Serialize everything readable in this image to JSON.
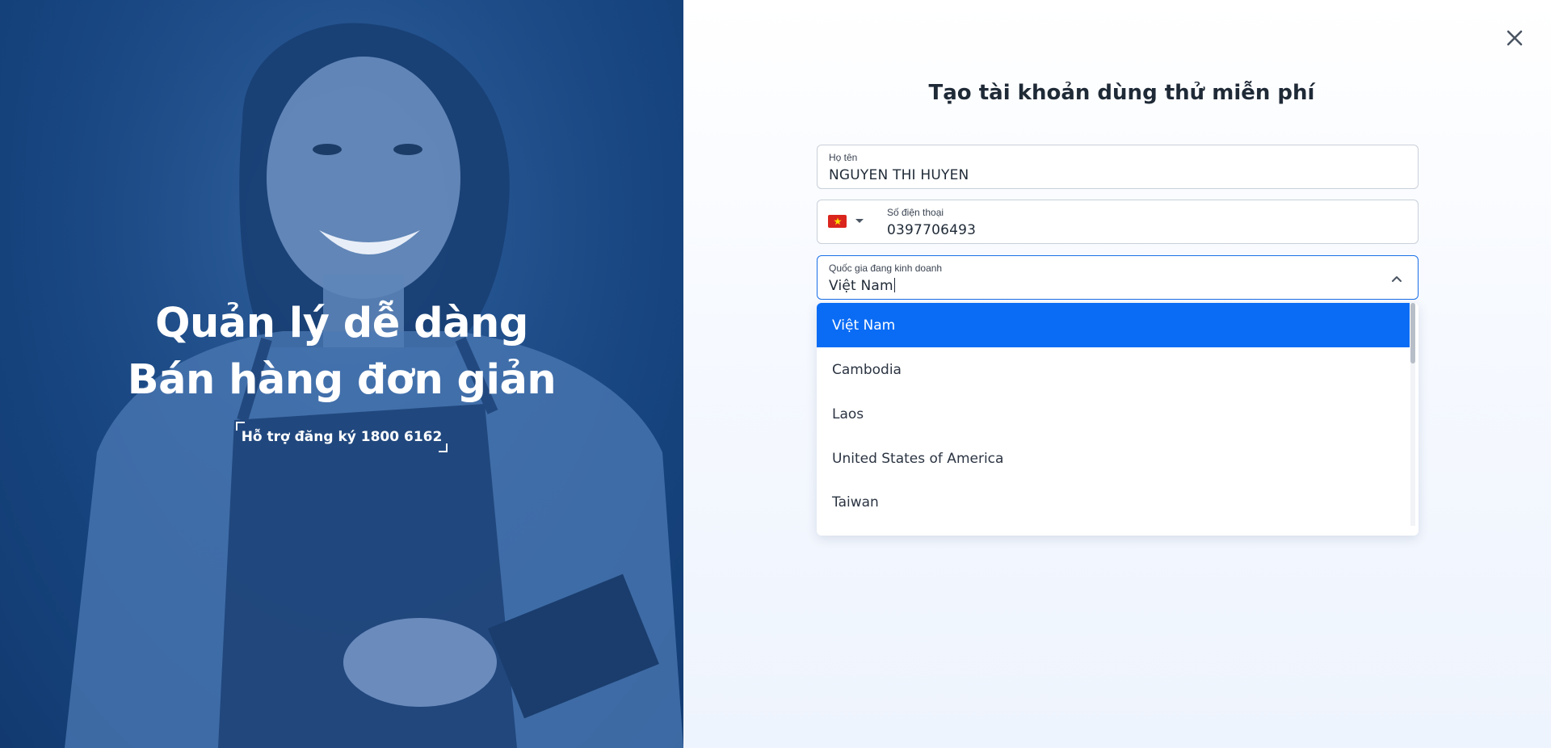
{
  "hero": {
    "title_line1": "Quản lý dễ dàng",
    "title_line2": "Bán hàng đơn giản",
    "hotline": "Hỗ trợ đăng ký 1800 6162"
  },
  "form": {
    "title": "Tạo tài khoản dùng thử miễn phí",
    "name": {
      "label": "Họ tên",
      "value": "NGUYEN THI HUYEN"
    },
    "phone": {
      "label": "Số điện thoại",
      "value": "0397706493",
      "flag": "vietnam-flag-icon"
    },
    "country": {
      "label": "Quốc gia đang kinh doanh",
      "value": "Việt Nam"
    }
  },
  "dropdown": {
    "options": [
      "Việt Nam",
      "Cambodia",
      "Laos",
      "United States of America",
      "Taiwan"
    ],
    "selected": "Việt Nam"
  },
  "colors": {
    "accent": "#0a6cf5",
    "hero_bg": "#174580",
    "focus_border": "#1a6fe8"
  },
  "icons": {
    "close": "close-icon",
    "dropdown": "caret-down-icon",
    "collapse": "chevron-up-icon"
  }
}
